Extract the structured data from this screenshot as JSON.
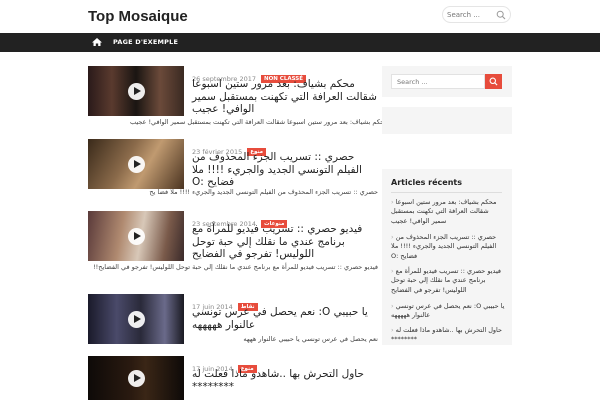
{
  "site": {
    "title": "Top Mosaique"
  },
  "header_search": {
    "placeholder": "Search ...",
    "icon": "search-icon"
  },
  "nav": {
    "home_icon": "home-icon",
    "items": [
      {
        "label": "PAGE D'EXEMPLE"
      }
    ]
  },
  "colors": {
    "accent": "#e74c3c",
    "navbar": "#222222",
    "sidebar_bg": "#f5f5f5"
  },
  "posts": [
    {
      "date": "26 septembre 2017",
      "category": "NON CLASSÉ",
      "title": "محكم بشياف: بعد مرور ستين اسبوعا شقالت العرافة التي تكهنت بمستقبل سمير الوافي! عجيب",
      "excerpt": "محكم بشياف: بعد مرور ستين اسبوعا شقالت العرافة التي تكهنت بمستقبل سمير الوافي! عجيب"
    },
    {
      "date": "23 février 2015",
      "category": "منوع",
      "title": "حصري :: تسريب الجزء المحذوف من الفيلم التونسي الجديد والجريء !!!! ملا فضايح :O",
      "excerpt": "حصري :: تسريب الجزء المحذوف من الفيلم التونسي الجديد والجريء !!!! ملا فضا يح"
    },
    {
      "date": "23 septembre 2014",
      "category": "منوعات",
      "title": "فيديو حصري :: تسريب فيديو للمرأة مع برنامج عندي ما نقلك إلي حبة توحل اللوليس! تفرجو في الفضايح",
      "excerpt": "فيديو حصري :: تسريب فيديو للمرأة مع برنامج عندي ما نقلك إلي حبة توحل اللوليس! تفرجو في الفضايح!!"
    },
    {
      "date": "17 juin 2014",
      "category": "نقاط",
      "title": "يا حبيبي O: نعم يحصل في عرس تونسي عالنوار هههههه",
      "excerpt": "نعم يحصل في عرس تونسي يا حبيبي عالنوار هههه"
    },
    {
      "date": "17 juin 2014",
      "category": "منوع",
      "title": "حاول التحرش بها ..شاهدو ماذا فعلت له ********",
      "excerpt": ""
    }
  ],
  "sidebar": {
    "search": {
      "placeholder": "Search ...",
      "icon": "search-icon"
    },
    "recent": {
      "title": "Articles récents",
      "items": [
        {
          "label": "محكم بشياف: بعد مرور ستين اسبوعا شقالت العرافة التي تكهنت بمستقبل سمير الوافي! عجيب"
        },
        {
          "label": "حصري :: تسريب الجزء المحذوف من الفيلم التونسي الجديد والجريء !!!! ملا فضايح :O"
        },
        {
          "label": "فيديو حصري :: تسريب فيديو للمرأة مع برنامج عندي ما نقلك إلي حبة توحل اللوليس! تفرجو في الفضايح"
        },
        {
          "label": "يا حبيبي O: نعم يحصل في عرس تونسي عالنوار هههههه"
        },
        {
          "label": "حاول التحرش بها ..شاهدو ماذا فعلت له ********"
        }
      ]
    }
  }
}
